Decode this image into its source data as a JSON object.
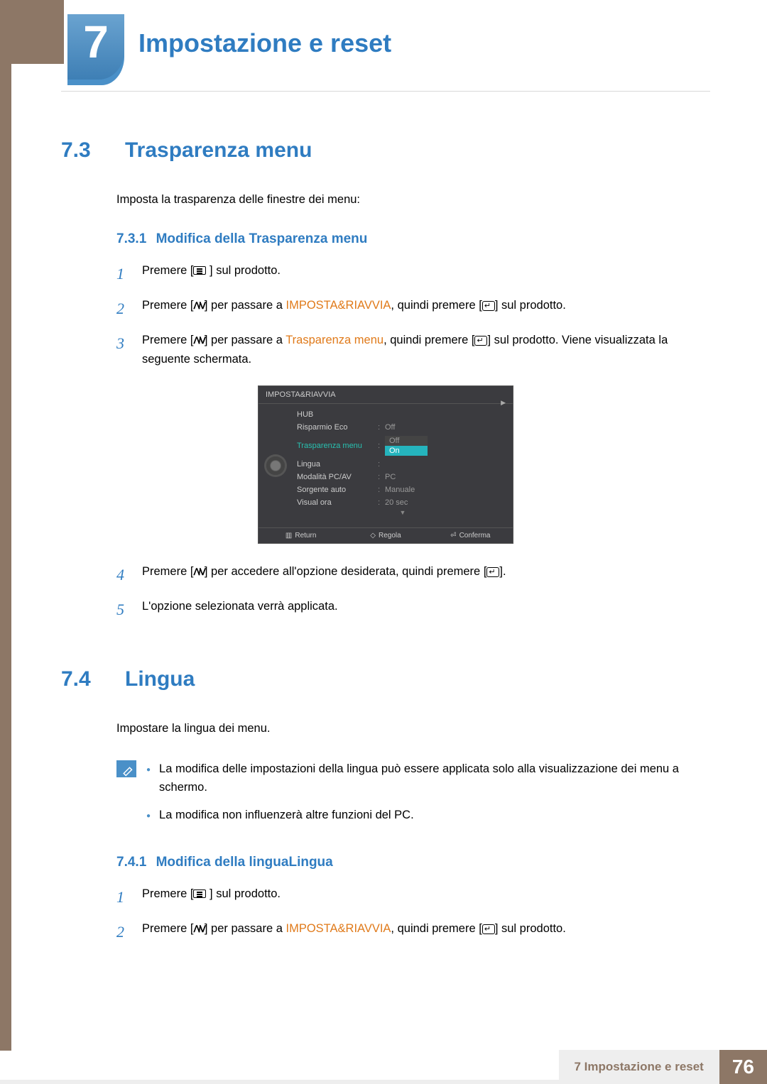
{
  "chapter": {
    "number": "7",
    "title": "Impostazione e reset"
  },
  "section73": {
    "num": "7.3",
    "title": "Trasparenza menu",
    "intro": "Imposta la trasparenza delle finestre dei menu:",
    "sub": {
      "num": "7.3.1",
      "title": "Modifica della Trasparenza menu"
    },
    "steps": {
      "s1": {
        "n": "1",
        "a": "Premere [",
        "b": " ] sul prodotto."
      },
      "s2": {
        "n": "2",
        "a": "Premere [",
        "b": "] per passare a ",
        "hl": "IMPOSTA&RIAVVIA",
        "c": ", quindi premere [",
        "d": "] sul prodotto."
      },
      "s3": {
        "n": "3",
        "a": "Premere [",
        "b": "] per passare a ",
        "hl": "Trasparenza menu",
        "c": ", quindi premere [",
        "d": "] sul prodotto. Viene visualizzata la seguente schermata."
      },
      "s4": {
        "n": "4",
        "a": "Premere [",
        "b": "] per accedere all'opzione desiderata, quindi premere [",
        "c": "]."
      },
      "s5": {
        "n": "5",
        "a": "L'opzione selezionata verrà applicata."
      }
    }
  },
  "osd": {
    "header": "IMPOSTA&RIAVVIA",
    "rows": {
      "hub": {
        "label": "HUB",
        "val": ""
      },
      "eco": {
        "label": "Risparmio Eco",
        "val": "Off"
      },
      "trans": {
        "label": "Trasparenza menu",
        "optOff": "Off",
        "optOn": "On"
      },
      "lingua": {
        "label": "Lingua",
        "val": ""
      },
      "pcav": {
        "label": "Modalità PC/AV",
        "val": "PC"
      },
      "src": {
        "label": "Sorgente auto",
        "val": "Manuale"
      },
      "time": {
        "label": "Visual ora",
        "val": "20 sec"
      }
    },
    "footer": {
      "ret": "Return",
      "adj": "Regola",
      "conf": "Conferma"
    }
  },
  "section74": {
    "num": "7.4",
    "title": "Lingua",
    "intro": "Impostare la lingua dei menu.",
    "notes": {
      "n1": "La modifica delle impostazioni della lingua può essere applicata solo alla visualizzazione dei menu a schermo.",
      "n2": "La modifica non influenzerà altre funzioni del PC."
    },
    "sub": {
      "num": "7.4.1",
      "title": "Modifica della linguaLingua"
    },
    "steps": {
      "s1": {
        "n": "1",
        "a": "Premere [",
        "b": " ] sul prodotto."
      },
      "s2": {
        "n": "2",
        "a": "Premere [",
        "b": "] per passare a ",
        "hl": "IMPOSTA&RIAVVIA",
        "c": ", quindi premere [",
        "d": "] sul prodotto."
      }
    }
  },
  "footer": {
    "text": "7 Impostazione e reset",
    "page": "76"
  }
}
